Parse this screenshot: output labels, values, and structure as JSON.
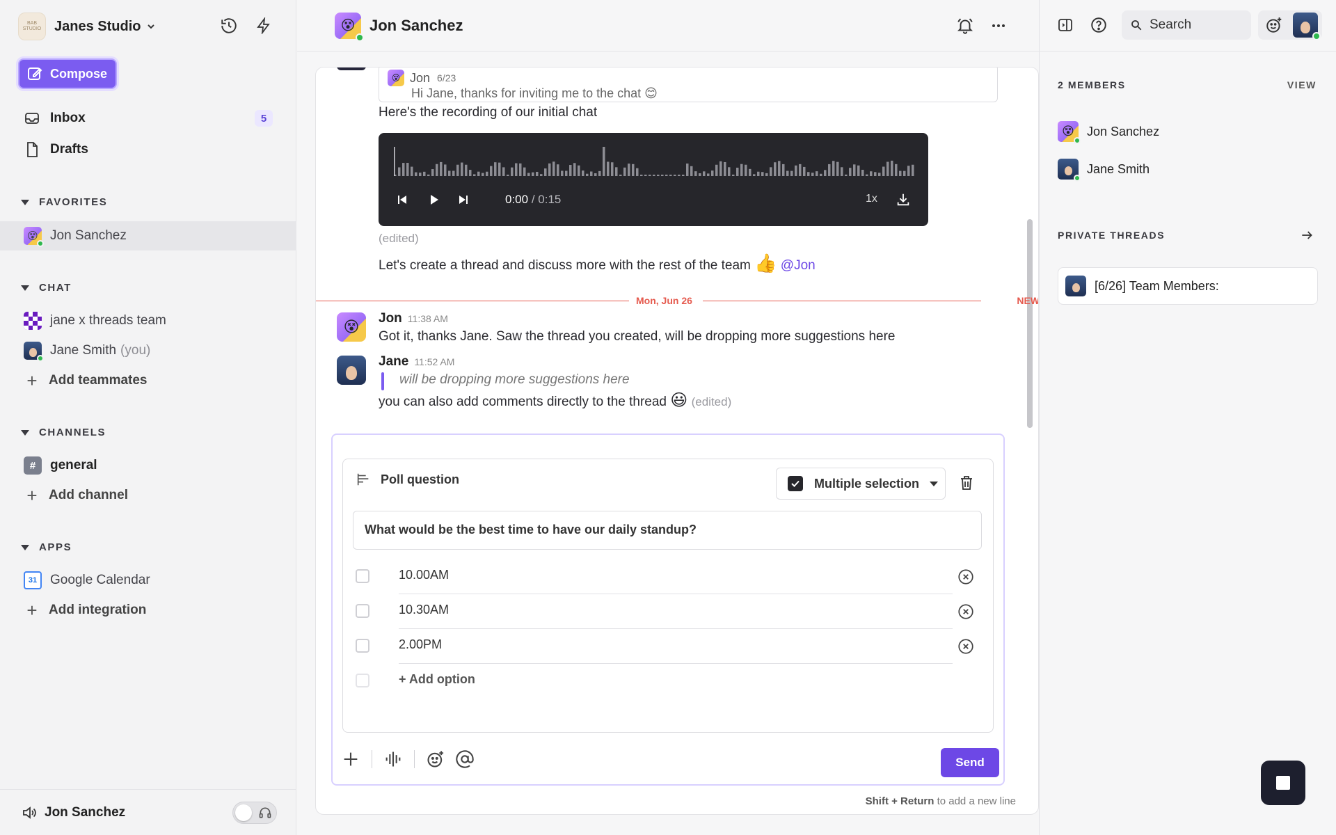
{
  "workspace": {
    "name": "Janes Studio",
    "logo_text": "BAB\nSTUDIO"
  },
  "sidebar": {
    "compose_label": "Compose",
    "nav": [
      {
        "label": "Inbox",
        "badge": "5",
        "icon": "inbox-icon"
      },
      {
        "label": "Drafts",
        "icon": "file-icon"
      }
    ],
    "favorites": {
      "title": "FAVORITES",
      "items": [
        {
          "label": "Jon Sanchez"
        }
      ]
    },
    "chat": {
      "title": "CHAT",
      "items": [
        {
          "label": "jane x threads team"
        },
        {
          "label": "Jane Smith",
          "suffix": "(you)"
        }
      ],
      "add_label": "Add teammates"
    },
    "channels": {
      "title": "CHANNELS",
      "items": [
        {
          "label": "general"
        }
      ],
      "add_label": "Add channel"
    },
    "apps": {
      "title": "APPS",
      "items": [
        {
          "label": "Google Calendar",
          "icon_text": "31"
        }
      ],
      "add_label": "Add integration"
    },
    "footer": {
      "label": "Jon Sanchez"
    }
  },
  "conversation": {
    "title": "Jon Sanchez",
    "quote": {
      "author": "Jon",
      "date": "6/23",
      "text": "Hi Jane, thanks for inviting me to the chat 😊"
    },
    "recording_text": "Here's the recording of our initial chat",
    "audio": {
      "current": "0:00",
      "duration": "/ 0:15",
      "speed": "1x",
      "progress": 0.0
    },
    "edited_label": "(edited)",
    "team_text": "Let's create a thread and discuss more with the rest of the team",
    "team_emoji": "👍",
    "mention": "@Jon",
    "divider": {
      "date": "Mon, Jun 26",
      "new_label": "NEW"
    },
    "messages": [
      {
        "author": "Jon",
        "time": "11:38 AM",
        "text": "Got it, thanks Jane. Saw the thread you created, will be dropping more suggestions here"
      },
      {
        "author": "Jane",
        "time": "11:52 AM",
        "quote": "will be dropping more suggestions here",
        "text": "you can also add comments directly to the thread",
        "emoji": "😃",
        "edited": "(edited)"
      }
    ]
  },
  "composer": {
    "poll": {
      "header": "Poll question",
      "mode": "Multiple selection",
      "question": "What would be the best time to have our daily standup?",
      "options": [
        "10.00AM",
        "10.30AM",
        "2.00PM"
      ],
      "add_option": "+ Add option"
    },
    "send_label": "Send",
    "hint_bold": "Shift + Return",
    "hint_rest": " to add a new line"
  },
  "right_panel": {
    "search_label": "Search",
    "members_title": "2 MEMBERS",
    "view_label": "VIEW",
    "members": [
      {
        "name": "Jon Sanchez"
      },
      {
        "name": "Jane Smith"
      }
    ],
    "threads_title": "PRIVATE THREADS",
    "threads": [
      {
        "label": "[6/26] Team Members:"
      }
    ]
  },
  "colors": {
    "accent": "#7b5cf0",
    "send": "#6d48e6",
    "new_divider": "#e55a4e",
    "online": "#2fb84e",
    "audio_bg": "#26262b"
  },
  "icons": [
    "history-icon",
    "bolt-icon",
    "compose-icon",
    "inbox-icon",
    "file-icon",
    "bell-icon",
    "more-icon",
    "sidebar-toggle-icon",
    "help-icon",
    "search-icon",
    "add-emoji-icon",
    "arrow-right-icon",
    "play-icon",
    "prev-icon",
    "next-icon",
    "download-icon",
    "poll-icon",
    "checkbox-icon",
    "trash-icon",
    "remove-option-icon",
    "plus-icon",
    "audio-icon",
    "emoji-icon",
    "mention-icon",
    "speaker-icon",
    "headphones-icon",
    "stop-icon"
  ]
}
